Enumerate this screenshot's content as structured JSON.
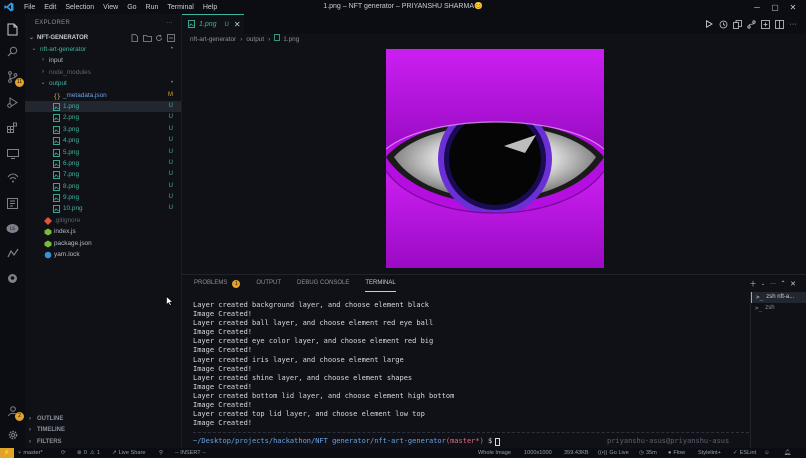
{
  "app": {
    "window_title": "1.png – NFT generator – PRIYANSHU SHARMA😊",
    "menu": [
      "File",
      "Edit",
      "Selection",
      "View",
      "Go",
      "Run",
      "Terminal",
      "Help"
    ],
    "accent": "#3fb59f",
    "warning": "#e2a32b"
  },
  "activity": {
    "scm_badge": "11",
    "accounts_badge": "2"
  },
  "sidebar": {
    "title": "EXPLORER",
    "more": "···",
    "project": "NFT-GENERATOR",
    "tree": [
      {
        "name": "nft-art-generator",
        "indent": 1,
        "type": "folder-open",
        "status": "•",
        "color": "#3fb59f"
      },
      {
        "name": "input",
        "indent": 2,
        "type": "folder",
        "status": "",
        "color": "#b8bcc6"
      },
      {
        "name": "node_modules",
        "indent": 2,
        "type": "folder",
        "status": "",
        "color": "#5c6370"
      },
      {
        "name": "output",
        "indent": 2,
        "type": "folder-open",
        "status": "•",
        "color": "#3fb59f"
      },
      {
        "name": "_metadata.json",
        "indent": 3,
        "type": "json",
        "status": "M",
        "color": "#6aa3e8"
      },
      {
        "name": "1.png",
        "indent": 3,
        "type": "png",
        "status": "U",
        "color": "#3fb59f",
        "selected": true
      },
      {
        "name": "2.png",
        "indent": 3,
        "type": "png",
        "status": "U",
        "color": "#3fb59f"
      },
      {
        "name": "3.png",
        "indent": 3,
        "type": "png",
        "status": "U",
        "color": "#3fb59f"
      },
      {
        "name": "4.png",
        "indent": 3,
        "type": "png",
        "status": "U",
        "color": "#3fb59f"
      },
      {
        "name": "5.png",
        "indent": 3,
        "type": "png",
        "status": "U",
        "color": "#3fb59f"
      },
      {
        "name": "6.png",
        "indent": 3,
        "type": "png",
        "status": "U",
        "color": "#3fb59f"
      },
      {
        "name": "7.png",
        "indent": 3,
        "type": "png",
        "status": "U",
        "color": "#3fb59f"
      },
      {
        "name": "8.png",
        "indent": 3,
        "type": "png",
        "status": "U",
        "color": "#3fb59f"
      },
      {
        "name": "9.png",
        "indent": 3,
        "type": "png",
        "status": "U",
        "color": "#3fb59f"
      },
      {
        "name": "10.png",
        "indent": 3,
        "type": "png",
        "status": "U",
        "color": "#3fb59f"
      },
      {
        "name": ".gitignore",
        "indent": 2,
        "type": "git",
        "status": "",
        "color": "#5c6370"
      },
      {
        "name": "index.js",
        "indent": 2,
        "type": "js",
        "status": "",
        "color": "#b8bcc6"
      },
      {
        "name": "package.json",
        "indent": 2,
        "type": "npm",
        "status": "",
        "color": "#b8bcc6"
      },
      {
        "name": "yarn.lock",
        "indent": 2,
        "type": "yarn",
        "status": "",
        "color": "#b8bcc6"
      }
    ],
    "outline": "OUTLINE",
    "timeline": "TIMELINE",
    "filters": "FILTERS"
  },
  "editor": {
    "tab_name": "1.png",
    "tab_status": "U",
    "breadcrumb": [
      "nft-art-generator",
      "output",
      "1.png"
    ]
  },
  "panel": {
    "tabs": [
      "PROBLEMS",
      "OUTPUT",
      "DEBUG CONSOLE",
      "TERMINAL"
    ],
    "problems_count": "1",
    "terminal_lines": [
      "Layer created background layer, and choose element black",
      "Image Created!",
      "Layer created ball layer, and choose element red eye ball",
      "Image Created!",
      "Layer created eye color layer, and choose element red big",
      "Image Created!",
      "Layer created iris layer, and choose element large",
      "Image Created!",
      "Layer created shine layer, and choose element shapes",
      "Image Created!",
      "Layer created bottom lid layer, and choose element high bottom",
      "Image Created!",
      "Layer created top lid layer, and choose element low top",
      "Image Created!"
    ],
    "prompt_path": "~/Desktop/projects/hackathon/NFT generator/nft-art-generator",
    "prompt_branch": "(master*)",
    "prompt_symbol": "$",
    "right_prompt": "priyanshu-asus@priyanshu-asus",
    "terminals": [
      "zsh nft-a...",
      "zsh"
    ]
  },
  "statusbar": {
    "branch": "master*",
    "errors": "0",
    "warnings": "1",
    "live_share": "Live Share",
    "mode": "-- INSERT --",
    "image_label": "Whole Image",
    "dimensions": "1000x1000",
    "size": "359.43KB",
    "go_live": "Go Live",
    "time": "35m",
    "flow": "Flow",
    "stylelint": "Stylelint+",
    "eslint": "ESLint"
  }
}
